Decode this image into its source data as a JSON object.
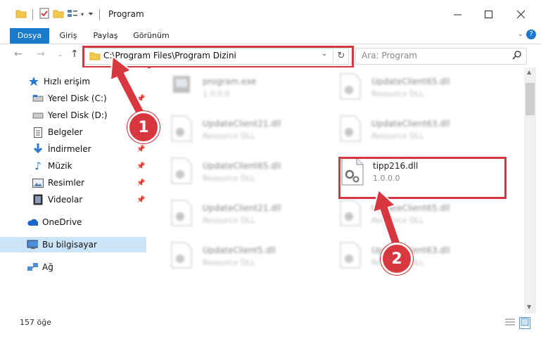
{
  "window": {
    "title": "Program"
  },
  "ribbon": {
    "tabs": [
      "Dosya",
      "Giriş",
      "Paylaş",
      "Görünüm"
    ]
  },
  "address": {
    "path": "C:\\Program Files\\Program Dizini"
  },
  "search": {
    "placeholder": "Ara: Program"
  },
  "sidebar": {
    "quick_access": "Hızlı erişim",
    "items": [
      "Yerel Disk (C:)",
      "Yerel Disk (D:)",
      "Belgeler",
      "İndirmeler",
      "Müzik",
      "Resimler",
      "Videolar"
    ],
    "onedrive": "OneDrive",
    "thispc": "Bu bilgisayar",
    "network": "Ağ"
  },
  "files": {
    "f1": {
      "name": "program.exe",
      "sub": "1.0.0.0"
    },
    "f2": {
      "name": "UpdateClient65.dll",
      "sub": "Resource DLL"
    },
    "f3": {
      "name": "UpdateClient21.dll",
      "sub": "Resource DLL"
    },
    "f4": {
      "name": "UpdateClient63.dll",
      "sub": "Resource DLL"
    },
    "f5": {
      "name": "UpdateClient65.dll",
      "sub": "Resource DLL"
    },
    "f6": {
      "name": "tipp216.dll",
      "sub": "1.0.0.0"
    },
    "f7": {
      "name": "UpdateClient21.dll",
      "sub": "Resource DLL"
    },
    "f8": {
      "name": "UpdateClient65.dll",
      "sub": "Resource DLL"
    },
    "f9": {
      "name": "UpdateClient5.dll",
      "sub": "Resource DLL"
    },
    "f10": {
      "name": "UpdateClient63.dll",
      "sub": "Resource DLL"
    }
  },
  "status": {
    "count": "157 öğe"
  },
  "callouts": {
    "one": "1",
    "two": "2"
  },
  "colors": {
    "accent": "#1979ca",
    "highlight": "#d9373f",
    "selected": "#cce4f7"
  }
}
